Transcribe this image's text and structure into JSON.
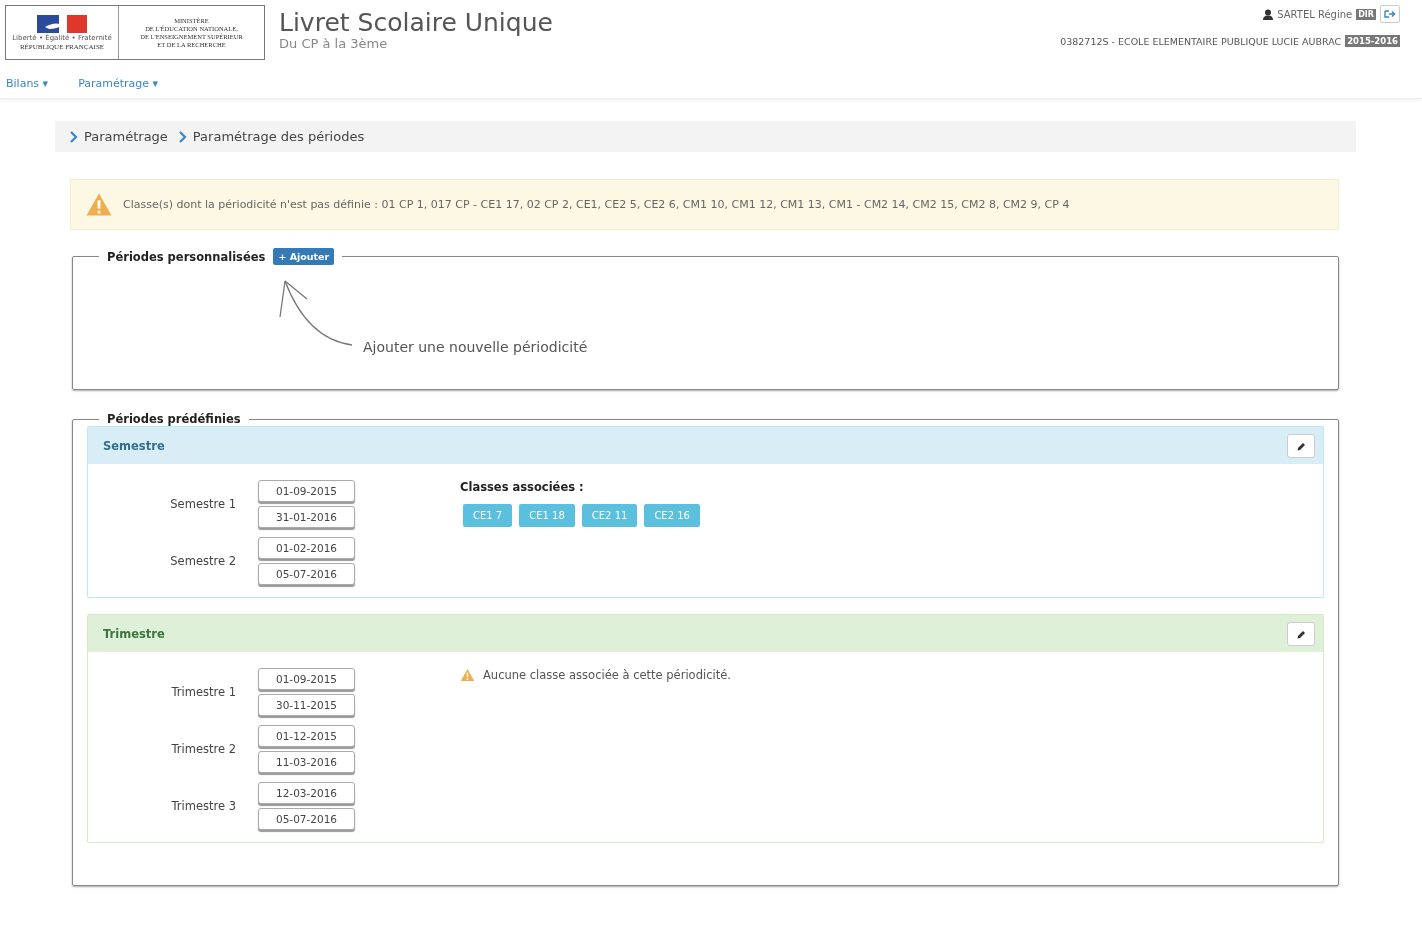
{
  "header": {
    "logo": {
      "motto": "Liberté • Égalité • Fraternité",
      "republic": "RÉPUBLIQUE FRANÇAISE",
      "ministry": [
        "MINISTÈRE",
        "DE L'ÉDUCATION NATIONALE,",
        "DE L'ENSEIGNEMENT SUPÉRIEUR",
        "ET DE LA RECHERCHE"
      ]
    },
    "title": "Livret Scolaire Unique",
    "subtitle": "Du CP à la 3ème",
    "user": {
      "name": "SARTEL Régine",
      "role": "DIR"
    },
    "school": "0382712S - ECOLE ELEMENTAIRE PUBLIQUE LUCIE AUBRAC",
    "year": "2015-2016"
  },
  "nav": [
    {
      "label": "Bilans",
      "caret": "▾"
    },
    {
      "label": "Paramétrage",
      "caret": "▾"
    }
  ],
  "breadcrumb": [
    "Paramétrage",
    "Paramétrage des périodes"
  ],
  "alert": "Classe(s) dont la périodicité n'est pas définie : 01 CP 1, 017 CP - CE1 17, 02 CP 2, CE1, CE2 5, CE2 6, CM1 10, CM1 12, CM1 13, CM1 - CM2 14, CM2 15, CM2 8, CM2 9, CP 4",
  "custom": {
    "legend": "Périodes personnalisées",
    "add_button": "+ Ajouter",
    "hint": "Ajouter une nouvelle périodicité"
  },
  "predefined": {
    "legend": "Périodes prédéfinies",
    "panels": [
      {
        "kind": "info",
        "title": "Semestre",
        "periods": [
          {
            "label": "Semestre 1",
            "start": "01-09-2015",
            "end": "31-01-2016"
          },
          {
            "label": "Semestre 2",
            "start": "01-02-2016",
            "end": "05-07-2016"
          }
        ],
        "classes_label": "Classes associées :",
        "classes": [
          "CE1 7",
          "CE1 18",
          "CE2 11",
          "CE2 16"
        ]
      },
      {
        "kind": "success",
        "title": "Trimestre",
        "periods": [
          {
            "label": "Trimestre 1",
            "start": "01-09-2015",
            "end": "30-11-2015"
          },
          {
            "label": "Trimestre 2",
            "start": "01-12-2015",
            "end": "11-03-2016"
          },
          {
            "label": "Trimestre 3",
            "start": "12-03-2016",
            "end": "05-07-2016"
          }
        ],
        "warning": "Aucune classe associée à cette périodicité."
      }
    ]
  }
}
